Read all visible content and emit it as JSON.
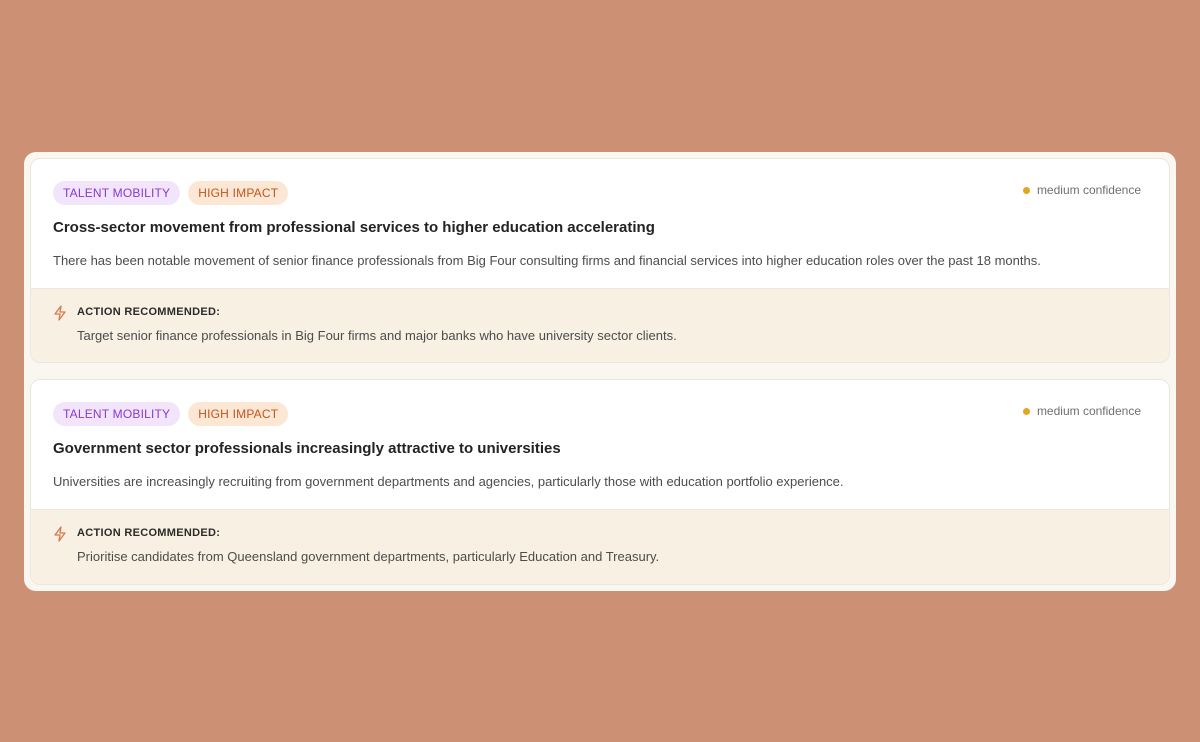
{
  "insights": [
    {
      "category": "TALENT MOBILITY",
      "impact": "HIGH IMPACT",
      "confidence": "medium confidence",
      "title": "Cross-sector movement from professional services to higher education accelerating",
      "description": "There has been notable movement of senior finance professionals from Big Four consulting firms and financial services into higher education roles over the past 18 months.",
      "action_label": "ACTION RECOMMENDED:",
      "action_text": "Target senior finance professionals in Big Four firms and major banks who have university sector clients."
    },
    {
      "category": "TALENT MOBILITY",
      "impact": "HIGH IMPACT",
      "confidence": "medium confidence",
      "title": "Government sector professionals increasingly attractive to universities",
      "description": "Universities are increasingly recruiting from government departments and agencies, particularly those with education portfolio experience.",
      "action_label": "ACTION RECOMMENDED:",
      "action_text": "Prioritise candidates from Queensland government departments, particularly Education and Treasury."
    }
  ],
  "icons": {
    "action": "lightning-icon",
    "confidence": "status-dot-icon"
  },
  "colors": {
    "background": "#cc9175",
    "category_badge": "#8a3ad0",
    "impact_badge": "#c4541e",
    "confidence_dot": "#e0a81a",
    "action_bg": "#f8f0e2"
  }
}
